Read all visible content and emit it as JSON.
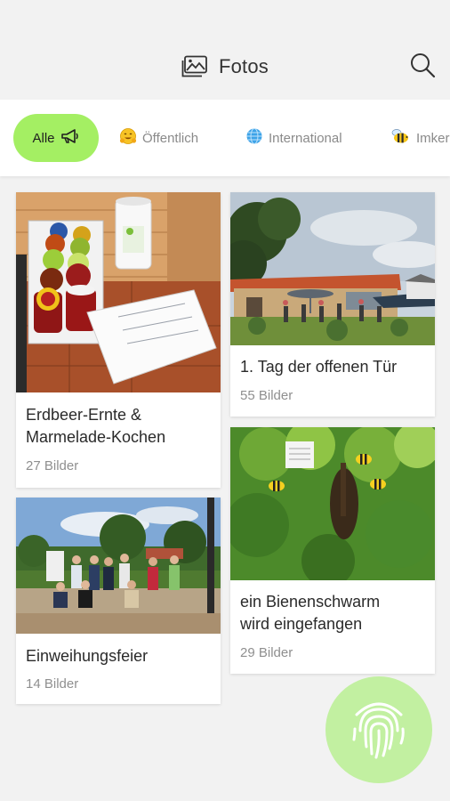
{
  "header": {
    "title": "Fotos",
    "title_icon": "image-gallery-icon",
    "search_icon": "search-icon"
  },
  "filters": [
    {
      "label": "Alle",
      "emoji": "📢",
      "active": true
    },
    {
      "label": "Öffentlich",
      "emoji": "🤗",
      "active": false
    },
    {
      "label": "International",
      "emoji": "🌐",
      "active": false
    },
    {
      "label": "Imker",
      "emoji": "🐝",
      "active": false
    }
  ],
  "albums": [
    {
      "title_line1": "Erdbeer-Ernte &",
      "title_line2": "Marmelade-Kochen",
      "count": "27 Bilder",
      "photo": "jam-jars-photo"
    },
    {
      "title_line1": "1. Tag der offenen Tür",
      "title_line2": "",
      "count": "55 Bilder",
      "photo": "open-day-photo"
    },
    {
      "title_line1": "Einweihungsfeier",
      "title_line2": "",
      "count": "14 Bilder",
      "photo": "group-photo"
    },
    {
      "title_line1": "ein Bienenschwarm",
      "title_line2": "wird eingefangen",
      "count": "29 Bilder",
      "photo": "bee-swarm-photo"
    }
  ],
  "fab": {
    "icon": "fingerprint-icon"
  },
  "colors": {
    "accent": "#a4ef63",
    "fab": "#c2f0a1",
    "background": "#f2f2f2"
  }
}
